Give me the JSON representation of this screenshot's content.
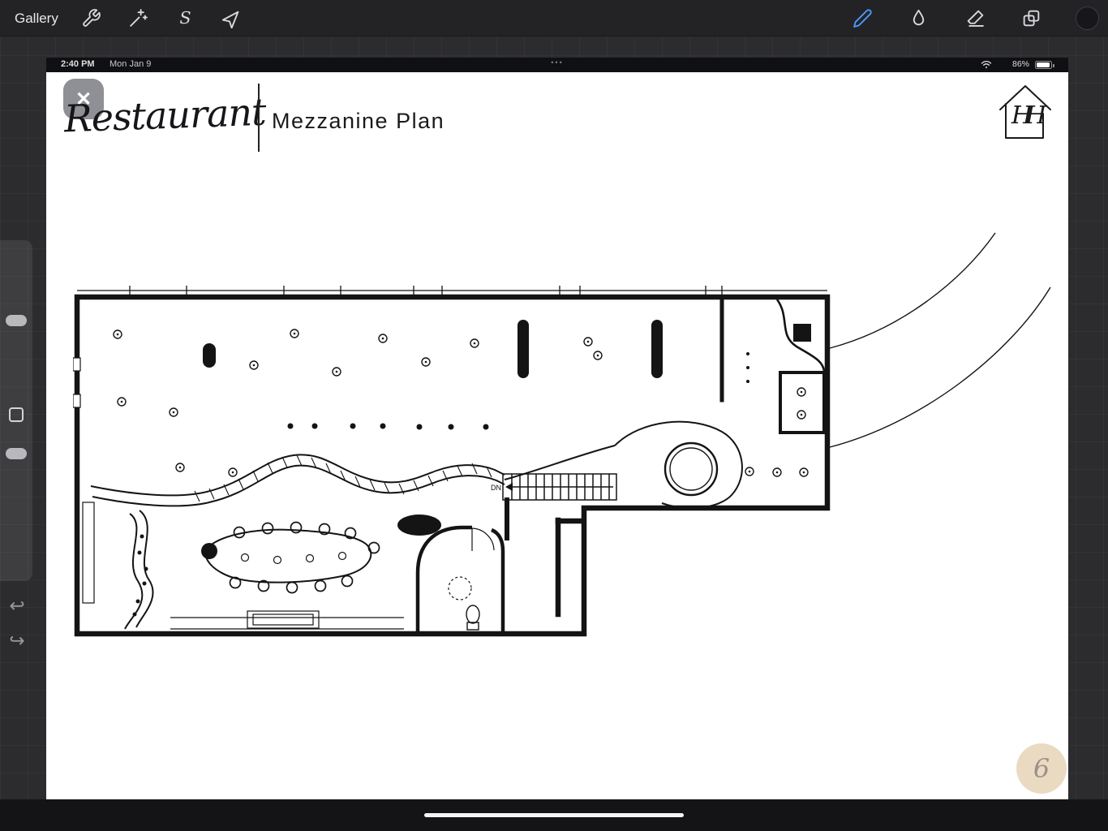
{
  "toolbar": {
    "gallery_label": "Gallery",
    "selection_glyph": "S",
    "active_tool": "brush",
    "accent_color": "#4a9bff",
    "left_icons": [
      "actions-wrench-icon",
      "adjustments-wand-icon",
      "selection-s-icon",
      "transform-arrow-icon"
    ],
    "right_icons": [
      "brush-icon",
      "smudge-icon",
      "eraser-icon",
      "layers-icon",
      "active-color-swatch"
    ]
  },
  "status_bar": {
    "time": "2:40 PM",
    "date": "Mon Jan 9",
    "battery_percent": "86%",
    "multitask_dots": "•••"
  },
  "sidebar": {
    "undo_glyph": "↩",
    "redo_glyph": "↪"
  },
  "canvas": {
    "close_glyph": "✕",
    "brand_script": "Restaurant",
    "page_title": "Mezzanine Plan",
    "logo_monogram": "HH",
    "page_number": "6",
    "labels": {
      "stairs": "DN"
    },
    "drawing_ink_color": "#141414",
    "page_circle_color": "#e9d8bf"
  }
}
